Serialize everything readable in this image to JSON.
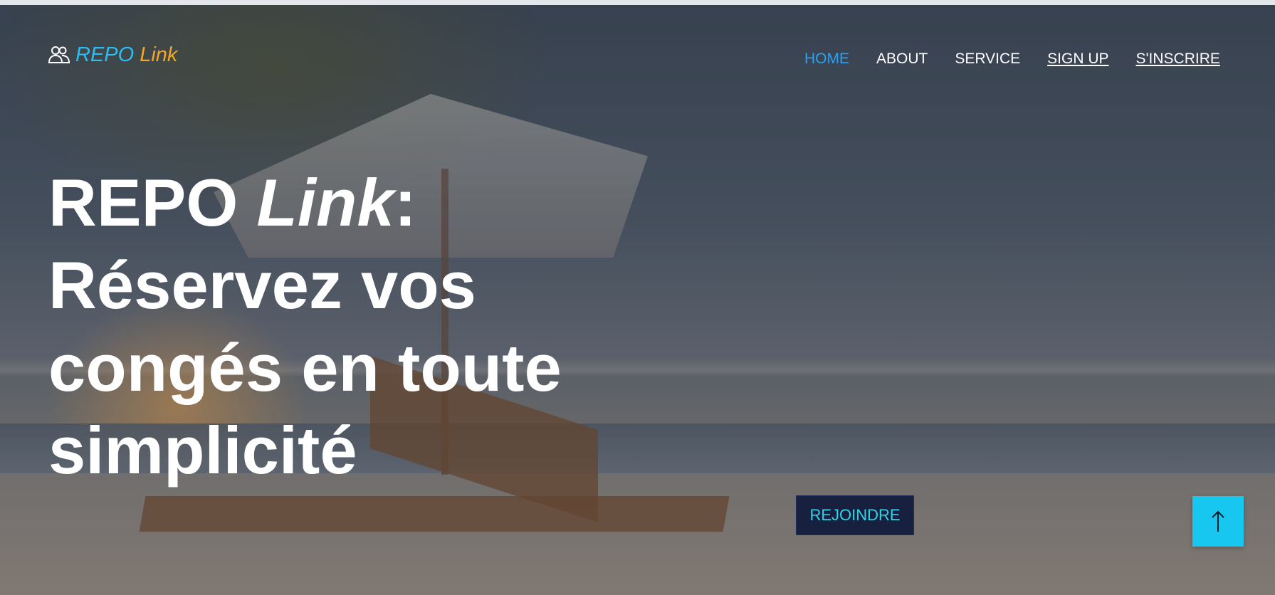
{
  "brand": {
    "icon": "users-icon",
    "word_1": "REPO",
    "word_2": "Link",
    "color_1": "#2dbcf0",
    "color_2": "#f2a52a"
  },
  "nav": {
    "items": [
      {
        "label": "HOME",
        "active": true,
        "underlined": false
      },
      {
        "label": "ABOUT",
        "active": false,
        "underlined": false
      },
      {
        "label": "SERVICE",
        "active": false,
        "underlined": false
      },
      {
        "label": "SIGN UP",
        "active": false,
        "underlined": true
      },
      {
        "label": "S'INSCRIRE",
        "active": false,
        "underlined": true
      }
    ],
    "active_color": "#2aa3f1"
  },
  "hero": {
    "title_part_1": "REPO ",
    "title_part_2": "Link",
    "title_part_3": ":",
    "line_2": "Réservez vos",
    "line_3": "congés en toute",
    "line_4": "simplicité",
    "cta_label": "REJOINDRE",
    "cta_background": "#17213f",
    "cta_text_color": "#2fd4e6"
  },
  "scroll_top": {
    "icon": "arrow-up-icon",
    "background": "#18c7f0"
  }
}
